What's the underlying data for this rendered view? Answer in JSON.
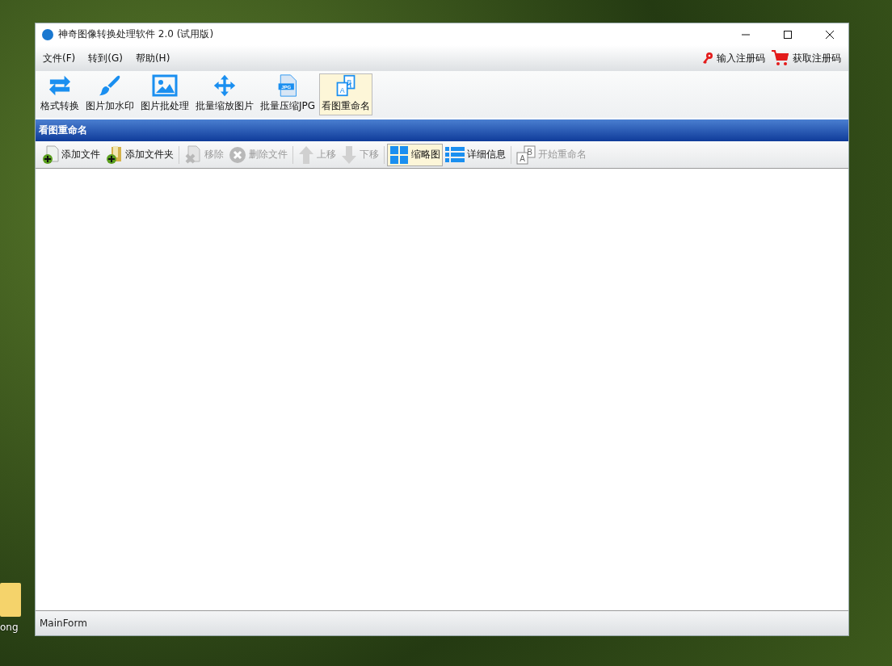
{
  "desktop": {
    "icon_label": "ong"
  },
  "window": {
    "title": "神奇图像转换处理软件 2.0 (试用版)"
  },
  "menu": [
    "文件(F)",
    "转到(G)",
    "帮助(H)"
  ],
  "registration": [
    {
      "label": "输入注册码",
      "kind": "key"
    },
    {
      "label": "获取注册码",
      "kind": "cart"
    }
  ],
  "tools": [
    {
      "label": "格式转换",
      "kind": "convert",
      "selected": false
    },
    {
      "label": "图片加水印",
      "kind": "brush",
      "selected": false
    },
    {
      "label": "图片批处理",
      "kind": "image",
      "selected": false
    },
    {
      "label": "批量缩放图片",
      "kind": "move",
      "selected": false
    },
    {
      "label": "批量压缩JPG",
      "kind": "jpg",
      "icon_text": [
        "JPG"
      ],
      "selected": false
    },
    {
      "label": "看图重命名",
      "kind": "rename",
      "icon_text": [
        "A",
        "B"
      ],
      "selected": true
    }
  ],
  "panel": {
    "title": "看图重命名"
  },
  "actions": [
    {
      "label": "添加文件",
      "kind": "add-file",
      "disabled": false,
      "selected": false
    },
    {
      "label": "添加文件夹",
      "kind": "add-folder",
      "disabled": false,
      "selected": false
    },
    {
      "label": "移除",
      "kind": "remove",
      "disabled": true,
      "selected": false
    },
    {
      "label": "删除文件",
      "kind": "delete",
      "disabled": true,
      "selected": false
    },
    {
      "label": "上移",
      "kind": "up",
      "disabled": true,
      "selected": false
    },
    {
      "label": "下移",
      "kind": "down",
      "disabled": true,
      "selected": false
    },
    {
      "label": "缩略图",
      "kind": "thumbs",
      "disabled": false,
      "selected": true
    },
    {
      "label": "详细信息",
      "kind": "details",
      "disabled": false,
      "selected": false
    },
    {
      "label": "开始重命名",
      "kind": "rename",
      "icon_text": [
        "A",
        "B"
      ],
      "disabled": true,
      "selected": false
    }
  ],
  "status_bar": {
    "text": "MainForm"
  }
}
